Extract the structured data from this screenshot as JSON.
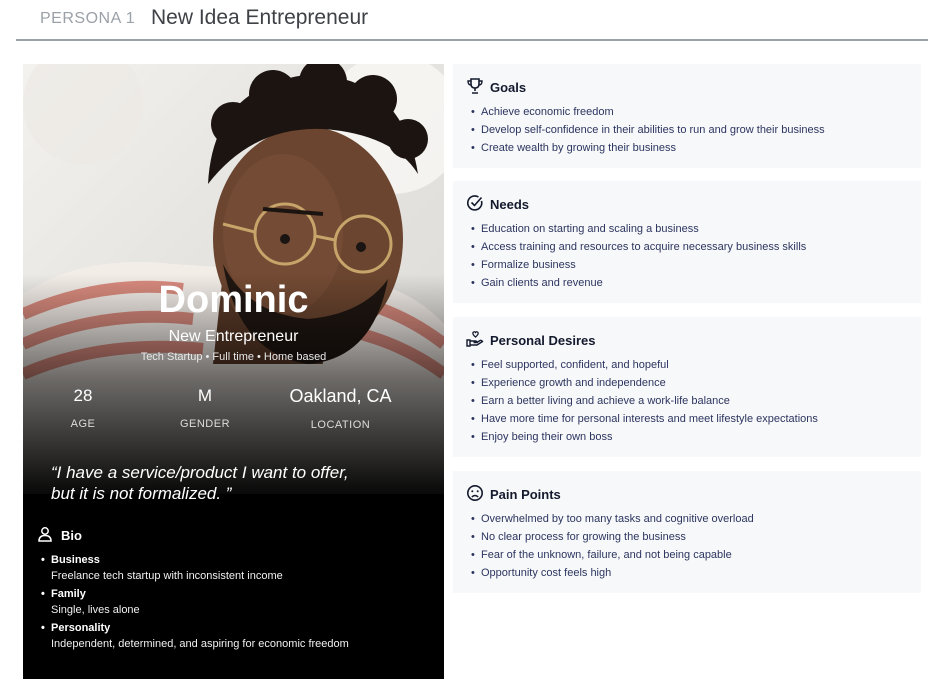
{
  "header": {
    "persona_label": "PERSONA 1",
    "title": "New Idea Entrepreneur"
  },
  "profile": {
    "name": "Dominic",
    "role": "New Entrepreneur",
    "meta": "Tech Startup • Full time • Home based",
    "stats": {
      "age": {
        "value": "28",
        "label": "AGE"
      },
      "gender": {
        "value": "M",
        "label": "GENDER"
      },
      "location": {
        "value": "Oakland, CA",
        "label": "LOCATION"
      }
    },
    "quote_line1": "“I have a service/product I want to offer,",
    "quote_line2": "but it is not formalized. ”",
    "bio": {
      "title": "Bio",
      "items": [
        {
          "heading": "Business",
          "value": "Freelance tech startup with inconsistent income"
        },
        {
          "heading": "Family",
          "value": "Single, lives alone"
        },
        {
          "heading": "Personality",
          "value": "Independent, determined, and aspiring for economic freedom"
        }
      ]
    }
  },
  "sections": {
    "goals": {
      "title": "Goals",
      "icon": "trophy-icon",
      "items": [
        "Achieve economic freedom",
        "Develop self-confidence in their abilities to run and grow their business",
        "Create wealth by growing their business"
      ]
    },
    "needs": {
      "title": "Needs",
      "icon": "check-circle-icon",
      "items": [
        "Education on starting and scaling a business",
        "Access training and resources to acquire necessary business skills",
        "Formalize business",
        "Gain clients and revenue"
      ]
    },
    "desires": {
      "title": "Personal Desires",
      "icon": "hand-heart-icon",
      "items": [
        "Feel supported, confident, and hopeful",
        "Experience growth and independence",
        "Earn a better living and achieve a work-life balance",
        "Have more time for personal interests and meet lifestyle expectations",
        "Enjoy being their own boss"
      ]
    },
    "pain": {
      "title": "Pain Points",
      "icon": "sad-face-icon",
      "items": [
        "Overwhelmed by too many tasks and cognitive overload",
        "No clear process for growing the business",
        "Fear of the unknown, failure, and not being capable",
        "Opportunity cost feels high"
      ]
    }
  },
  "colors": {
    "card_bg": "#000000",
    "panel_bg": "#f7f8f9",
    "list_text": "#2c3560",
    "heading_text": "#141a2e"
  }
}
